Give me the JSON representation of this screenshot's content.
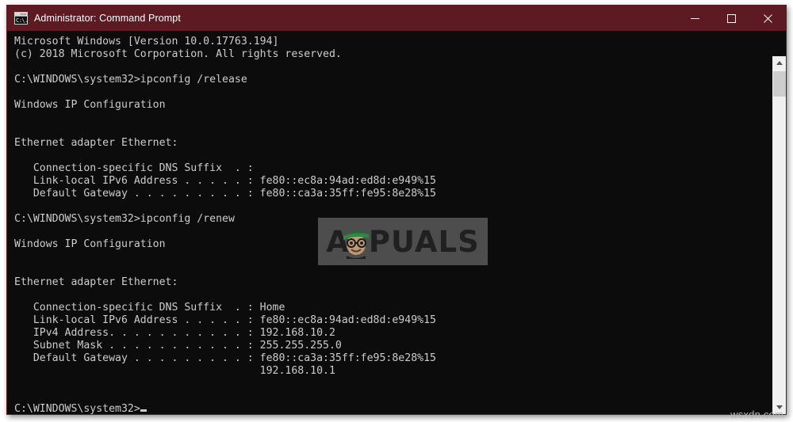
{
  "window": {
    "title": "Administrator: Command Prompt",
    "icon_name": "cmd-icon",
    "icon_glyph": "C:\\.",
    "titlebar_color": "#5d1a23",
    "console_bg": "#0c0c0c",
    "console_fg": "#cccccc",
    "buttons": {
      "minimize_label": "─",
      "maximize_label": "☐",
      "close_label": "✕"
    }
  },
  "console": {
    "lines": [
      "Microsoft Windows [Version 10.0.17763.194]",
      "(c) 2018 Microsoft Corporation. All rights reserved.",
      "",
      "C:\\WINDOWS\\system32>ipconfig /release",
      "",
      "Windows IP Configuration",
      "",
      "",
      "Ethernet adapter Ethernet:",
      "",
      "   Connection-specific DNS Suffix  . :",
      "   Link-local IPv6 Address . . . . . : fe80::ec8a:94ad:ed8d:e949%15",
      "   Default Gateway . . . . . . . . . : fe80::ca3a:35ff:fe95:8e28%15",
      "",
      "C:\\WINDOWS\\system32>ipconfig /renew",
      "",
      "Windows IP Configuration",
      "",
      "",
      "Ethernet adapter Ethernet:",
      "",
      "   Connection-specific DNS Suffix  . : Home",
      "   Link-local IPv6 Address . . . . . : fe80::ec8a:94ad:ed8d:e949%15",
      "   IPv4 Address. . . . . . . . . . . : 192.168.10.2",
      "   Subnet Mask . . . . . . . . . . . : 255.255.255.0",
      "   Default Gateway . . . . . . . . . : fe80::ca3a:35ff:fe95:8e28%15",
      "                                       192.168.10.1",
      "",
      ""
    ],
    "prompt": "C:\\WINDOWS\\system32>"
  },
  "scrollbar": {
    "up_arrow": "up-arrow",
    "down_arrow": "down-arrow",
    "thumb": "scrollbar-thumb"
  },
  "watermarks": {
    "logo_text": "A    PUALS",
    "logo_left": "A",
    "logo_right": "PUALS",
    "bottom_right": "wsxdn.com"
  }
}
